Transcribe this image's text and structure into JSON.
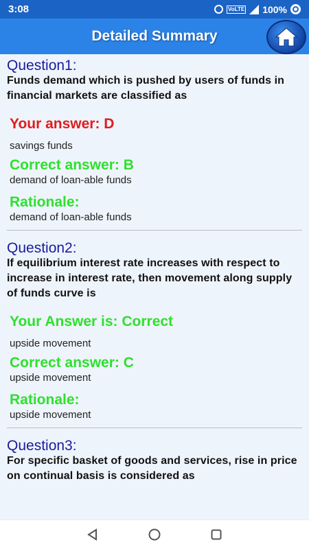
{
  "status_bar": {
    "time": "3:08",
    "battery": "100%",
    "icons": [
      "alarm-icon",
      "volte-icon",
      "signal-icon",
      "data-saver-icon"
    ]
  },
  "app_bar": {
    "title": "Detailed Summary",
    "home_icon": "home-icon"
  },
  "colors": {
    "status_bar": "#1b63c5",
    "app_bar": "#2b83e8",
    "question_title": "#1b1b9c",
    "wrong": "#e11c1c",
    "correct": "#2ee02e"
  },
  "questions": [
    {
      "title": "Question1:",
      "text": "Funds demand which is pushed by users of funds in financial markets are classified as",
      "your_answer_label": "Your answer: D",
      "your_answer_text": "savings funds",
      "correct_label": "Correct answer: B",
      "correct_text": "demand of loan-able funds",
      "rationale_label": "Rationale:",
      "rationale_text": "demand of loan-able funds"
    },
    {
      "title": "Question2:",
      "text": "If equilibrium interest rate increases with respect to increase in interest rate, then movement along supply of funds curve is",
      "your_answer_label": "Your Answer is: Correct",
      "your_answer_text": "upside movement",
      "correct_label": "Correct answer: C",
      "correct_text": "upside movement",
      "rationale_label": "Rationale:",
      "rationale_text": "upside movement"
    },
    {
      "title": "Question3:",
      "text": "For specific basket of goods and services, rise in price on continual basis is considered as"
    }
  ],
  "nav_bar": {
    "icons": [
      "back-icon",
      "home-circle-icon",
      "recents-icon"
    ]
  }
}
